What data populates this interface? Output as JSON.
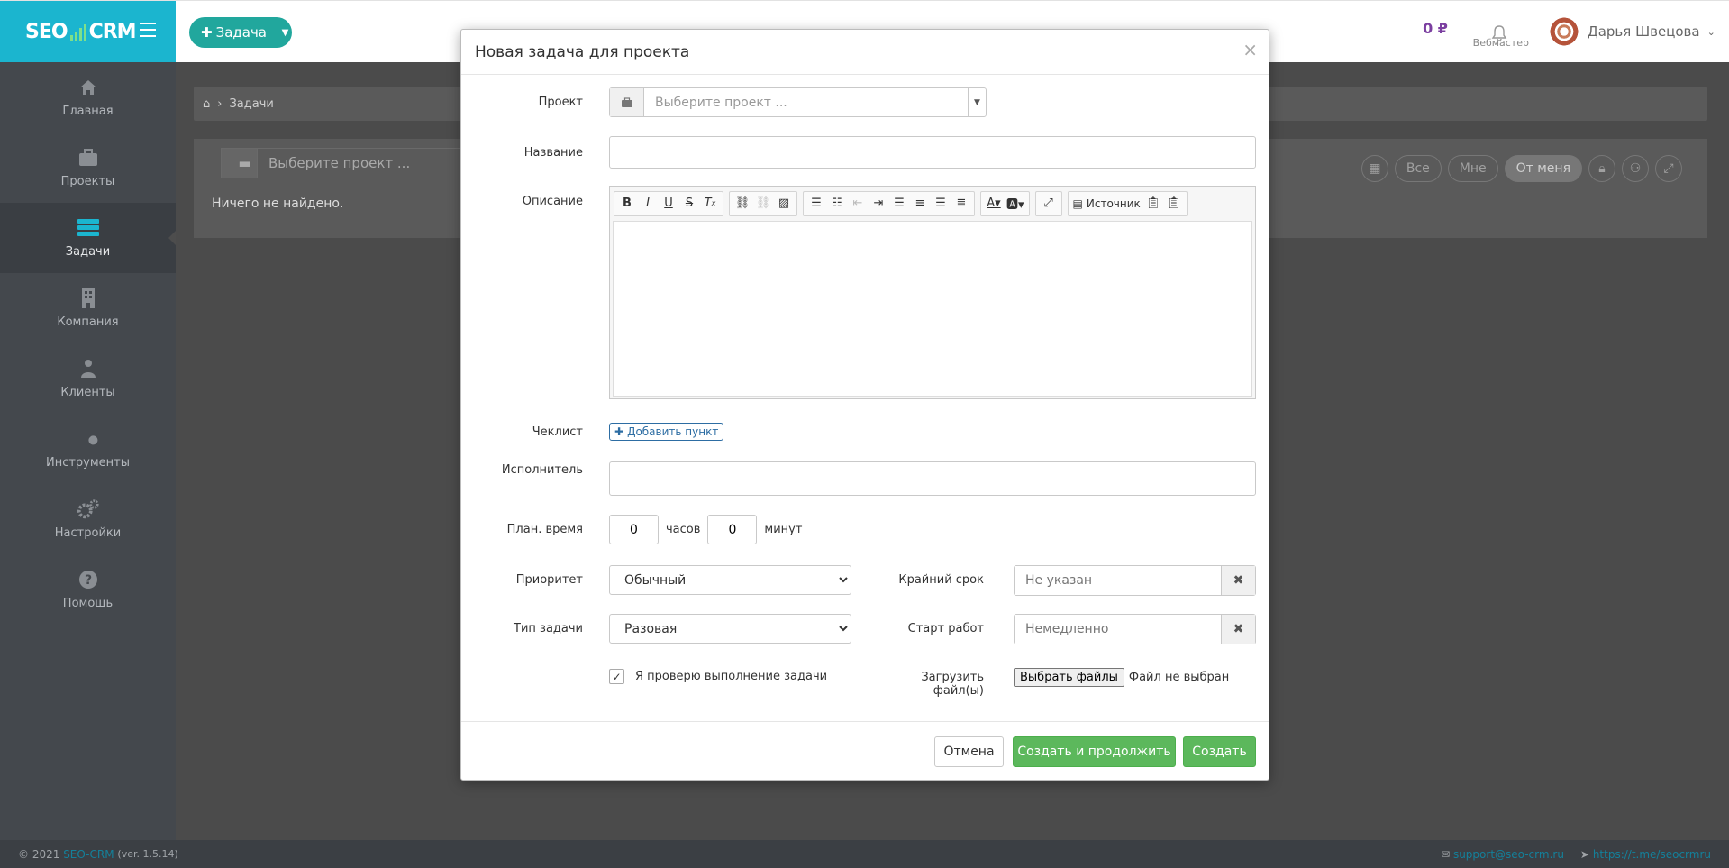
{
  "header": {
    "logo_left": "SEO",
    "logo_right": "CRM",
    "new_task_label": "Задача",
    "balance": "0 ₽",
    "role": "Вебмастер",
    "user_name": "Дарья Швецова"
  },
  "sidebar": {
    "items": [
      {
        "label": "Главная",
        "icon": "home-icon"
      },
      {
        "label": "Проекты",
        "icon": "briefcase-icon"
      },
      {
        "label": "Задачи",
        "icon": "tasks-icon",
        "active": true
      },
      {
        "label": "Компания",
        "icon": "building-icon"
      },
      {
        "label": "Клиенты",
        "icon": "users-icon"
      },
      {
        "label": "Инструменты",
        "icon": "wrench-icon"
      },
      {
        "label": "Настройки",
        "icon": "gears-icon"
      },
      {
        "label": "Помощь",
        "icon": "help-icon"
      }
    ]
  },
  "page": {
    "breadcrumb": "Задачи",
    "project_placeholder": "Выберите проект ...",
    "empty": "Ничего не найдено.",
    "filters": [
      "Все",
      "Мне",
      "От меня"
    ]
  },
  "modal": {
    "title": "Новая задача для проекта",
    "project_label": "Проект",
    "project_placeholder": "Выберите проект ...",
    "name_label": "Название",
    "description_label": "Описание",
    "source_label": "Источник",
    "checklist_label": "Чеклист",
    "add_item_label": "Добавить пункт",
    "assignee_label": "Исполнитель",
    "plan_time_label": "План. время",
    "hours_value": "0",
    "hours_unit": "часов",
    "minutes_value": "0",
    "minutes_unit": "минут",
    "priority_label": "Приоритет",
    "priority_value": "Обычный",
    "deadline_label": "Крайний срок",
    "deadline_placeholder": "Не указан",
    "task_type_label": "Тип задачи",
    "task_type_value": "Разовая",
    "start_label": "Старт работ",
    "start_placeholder": "Немедленно",
    "verify_label": "Я проверю выполнение задачи",
    "upload_label": "Загрузить файл(ы)",
    "choose_files": "Выбрать файлы",
    "no_file": "Файл не выбран",
    "cancel": "Отмена",
    "create_continue": "Создать и продолжить",
    "create": "Создать"
  },
  "footer": {
    "copyright": "© 2021",
    "brand": "SEO-CRM",
    "version": "(ver. 1.5.14)",
    "email": "support@seo-crm.ru",
    "telegram": "https://t.me/seocrmru"
  }
}
